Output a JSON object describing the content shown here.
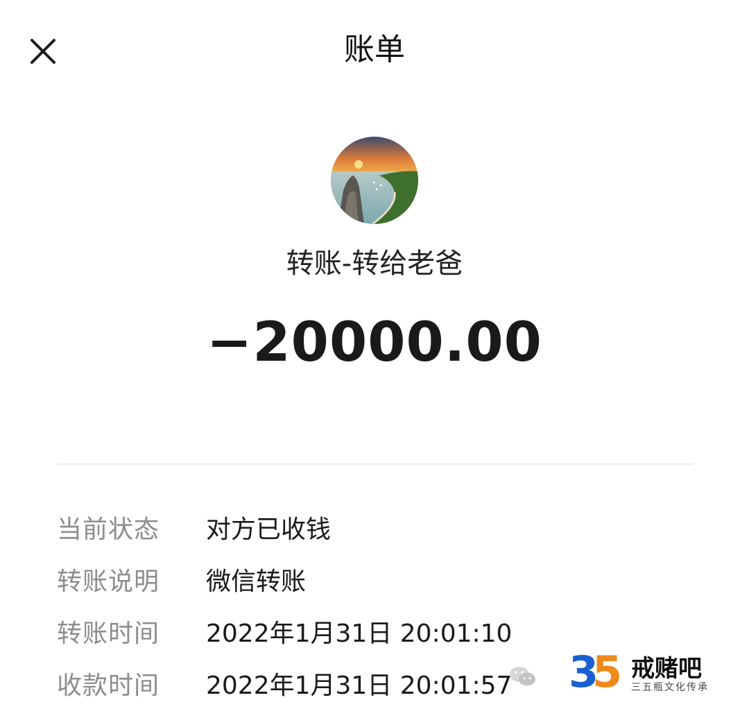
{
  "header": {
    "title": "账单",
    "close_icon": "close-icon"
  },
  "transaction": {
    "avatar_icon": "avatar-landscape-photo",
    "title": "转账-转给老爸",
    "amount": "−20000.00"
  },
  "details": [
    {
      "label": "当前状态",
      "value": "对方已收钱"
    },
    {
      "label": "转账说明",
      "value": "微信转账"
    },
    {
      "label": "转账时间",
      "value": "2022年1月31日 20:01:10"
    },
    {
      "label": "收款时间",
      "value": "2022年1月31日 20:01:57"
    }
  ],
  "watermark": {
    "logo_text": "35",
    "name": "戒赌吧",
    "subtitle": "三五瓶文化传承",
    "wechat_icon": "wechat-icon"
  },
  "colors": {
    "background": "#ffffff",
    "label": "#8c8c8c",
    "value": "#1a1a1a",
    "divider": "#ececec",
    "logo_blue": "#1a5fd0",
    "logo_orange": "#f08a1c"
  }
}
